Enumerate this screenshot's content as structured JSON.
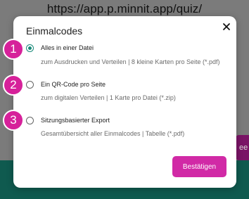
{
  "background": {
    "url_text": "https://app.p.minnit.app/quiz/",
    "edge_button_fragment": "ee"
  },
  "dialog": {
    "title": "Einmalcodes",
    "options": [
      {
        "badge": "1",
        "label": "Alles in einer Datei",
        "description": "zum Ausdrucken und Verteilen | 8 kleine Karten pro Seite (*.pdf)",
        "selected": true
      },
      {
        "badge": "2",
        "label": "Ein QR-Code pro Seite",
        "description": "zum digitalen Verteilen | 1 Karte pro Datei (*.zip)",
        "selected": false
      },
      {
        "badge": "3",
        "label": "Sitzungsbasierter Export",
        "description": "Gesamtübersicht aller Einmalcodes | Tabelle (*.pdf)",
        "selected": false
      }
    ],
    "confirm_label": "Bestätigen"
  },
  "colors": {
    "accent_pink": "#d12aa6",
    "radio_teal": "#1a8a7a",
    "badge_pink": "#d6219a"
  }
}
